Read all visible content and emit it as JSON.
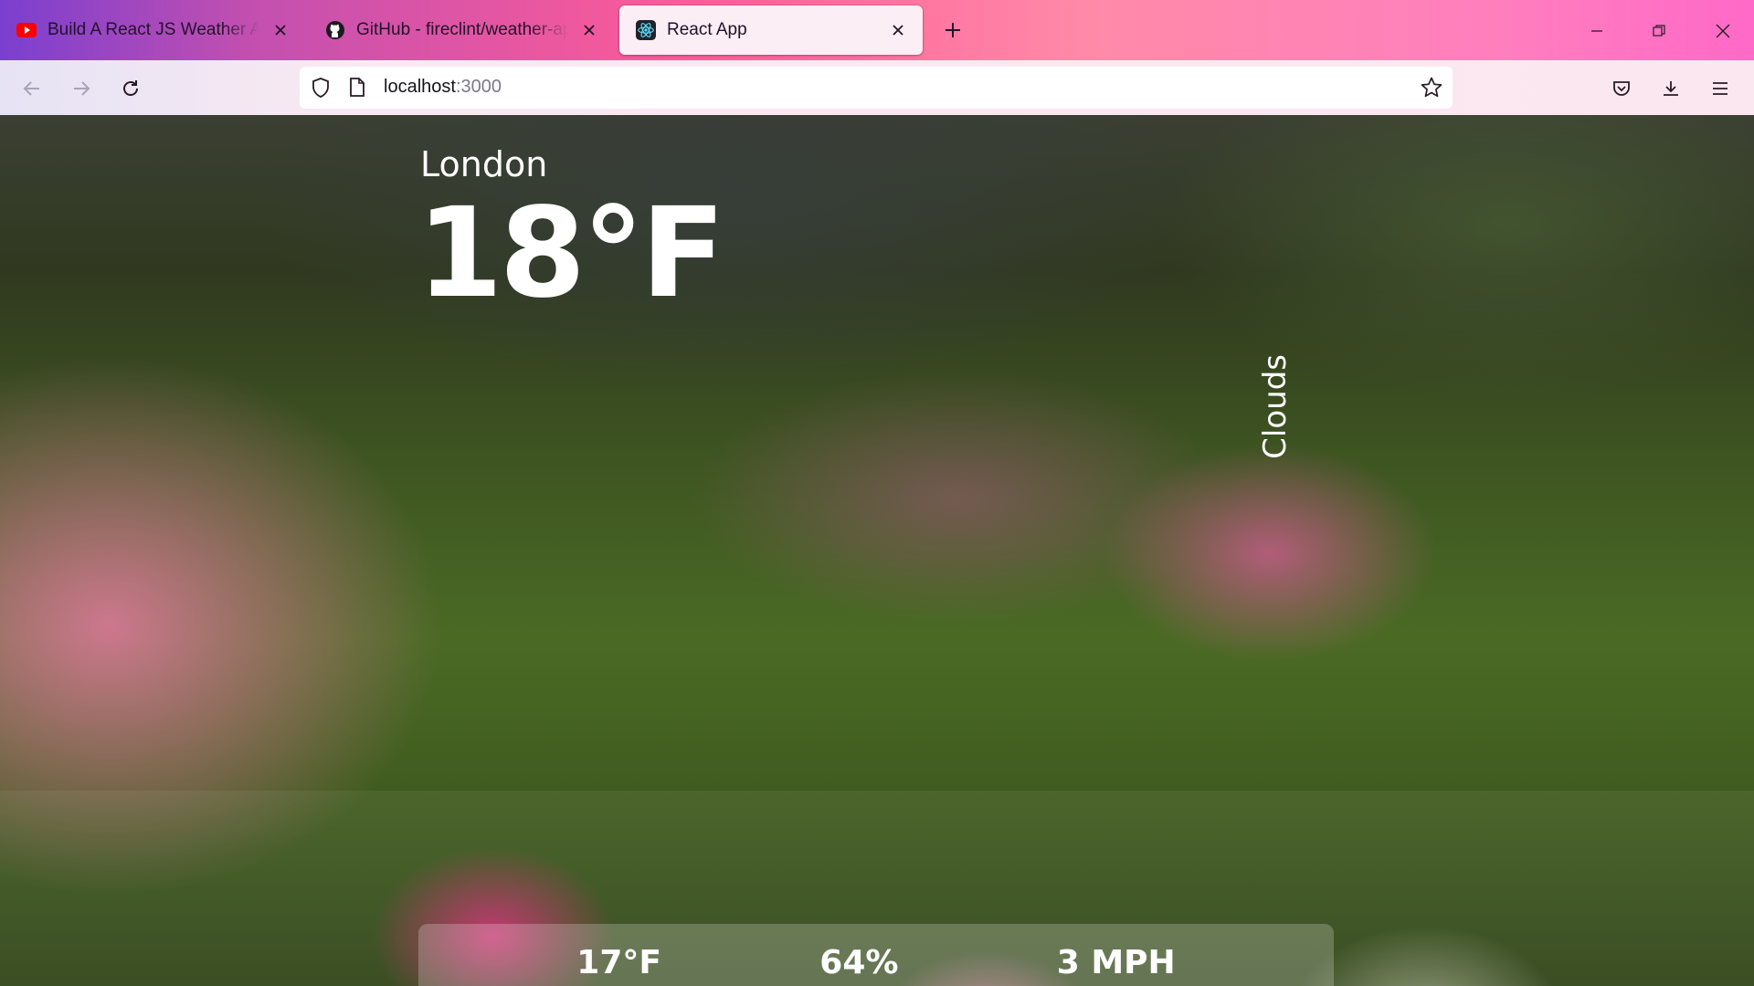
{
  "browser": {
    "tabs": [
      {
        "title": "Build A React JS Weather App - ",
        "icon": "youtube-icon",
        "active": false
      },
      {
        "title": "GitHub - fireclint/weather-app-",
        "icon": "github-icon",
        "active": false
      },
      {
        "title": "React App",
        "icon": "react-icon",
        "active": true
      }
    ],
    "url_host": "localhost",
    "url_port": ":3000"
  },
  "weather": {
    "location": "London",
    "temperature": "18°F",
    "description": "Clouds",
    "feels_like": "17°F",
    "humidity": "64%",
    "wind": "3 MPH"
  },
  "colors": {
    "text": "#ffffff",
    "active_tab": "#fbeef4"
  }
}
